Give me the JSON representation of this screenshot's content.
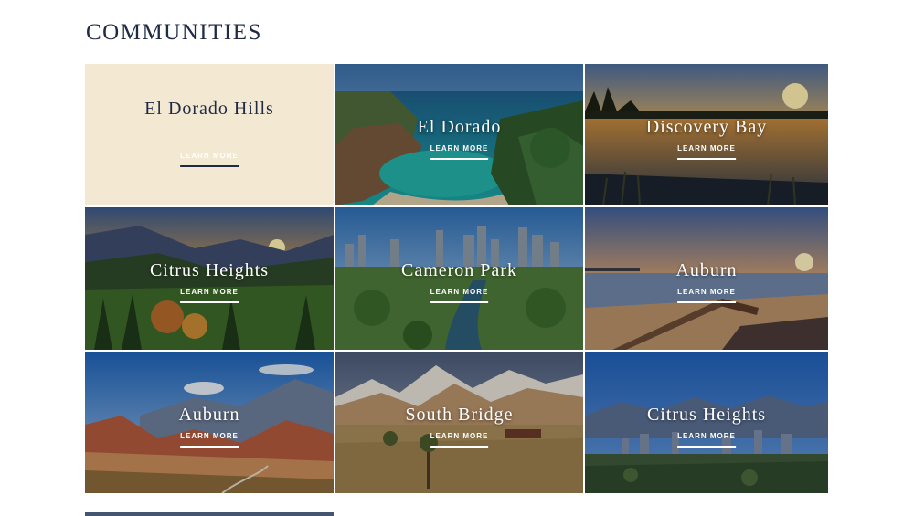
{
  "section": {
    "title": "COMMUNITIES"
  },
  "tiles": [
    {
      "name": "El Dorado Hills",
      "cta": "LEARN MORE",
      "scene": "plain"
    },
    {
      "name": "El Dorado",
      "cta": "LEARN MORE",
      "scene": "coast-cove"
    },
    {
      "name": "Discovery Bay",
      "cta": "LEARN MORE",
      "scene": "lake-sunset"
    },
    {
      "name": "Citrus Heights",
      "cta": "LEARN MORE",
      "scene": "mountain-forest-sunset"
    },
    {
      "name": "Cameron Park",
      "cta": "LEARN MORE",
      "scene": "city-river-aerial"
    },
    {
      "name": "Auburn",
      "cta": "LEARN MORE",
      "scene": "pier-beach-sunset"
    },
    {
      "name": "Auburn",
      "cta": "LEARN MORE",
      "scene": "red-rock-canyon"
    },
    {
      "name": "South Bridge",
      "cta": "LEARN MORE",
      "scene": "snowy-peaks-prairie"
    },
    {
      "name": "Citrus Heights",
      "cta": "LEARN MORE",
      "scene": "city-skyline-mountains"
    }
  ],
  "colors": {
    "title": "#1f2a44",
    "plain_tile_bg": "#f3e9d2",
    "overlay_text": "#ffffff"
  }
}
